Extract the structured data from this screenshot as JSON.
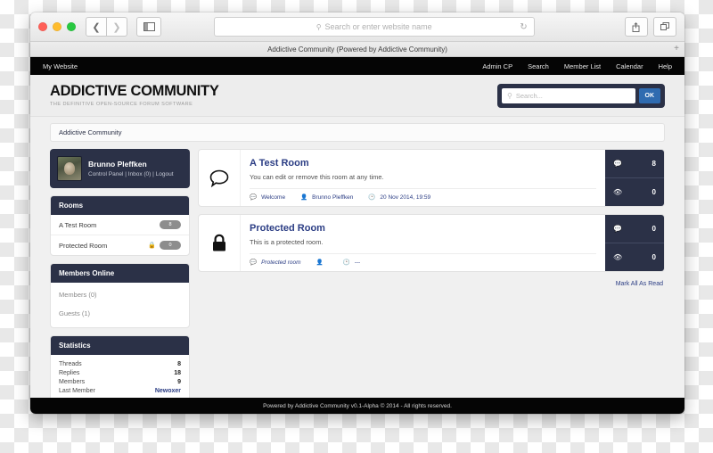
{
  "browser": {
    "url_placeholder": "Search or enter website name",
    "tab_title": "Addictive Community (Powered by Addictive Community)",
    "back_icon": "chevron-left-icon",
    "forward_icon": "chevron-right-icon",
    "sidebar_icon": "sidebar-toggle-icon",
    "reload_icon": "reload-icon",
    "share_icon": "share-icon",
    "tabs_icon": "tabs-icon",
    "new_tab_label": "+"
  },
  "topnav": {
    "site_label": "My Website",
    "items": [
      "Admin CP",
      "Search",
      "Member List",
      "Calendar",
      "Help"
    ]
  },
  "header": {
    "logo_title": "ADDICTIVE COMMUNITY",
    "logo_subtitle": "THE DEFINITIVE OPEN-SOURCE FORUM SOFTWARE",
    "search_placeholder": "Search...",
    "search_value": "",
    "search_button": "OK"
  },
  "breadcrumb": "Addictive Community",
  "sidebar": {
    "user": {
      "name": "Brunno Pleffken",
      "links": "Control Panel | Inbox (0) | Logout"
    },
    "rooms": {
      "title": "Rooms",
      "items": [
        {
          "label": "A Test Room",
          "count": "8",
          "locked": false
        },
        {
          "label": "Protected Room",
          "count": "0",
          "locked": true
        }
      ]
    },
    "members_online": {
      "title": "Members Online",
      "items": [
        "Members (0)",
        "Guests (1)"
      ]
    },
    "statistics": {
      "title": "Statistics",
      "rows": [
        {
          "label": "Threads",
          "value": "8",
          "link": false
        },
        {
          "label": "Replies",
          "value": "18",
          "link": false
        },
        {
          "label": "Members",
          "value": "9",
          "link": false
        },
        {
          "label": "Last Member",
          "value": "Newoxer",
          "link": true
        }
      ]
    }
  },
  "main": {
    "rooms": [
      {
        "icon": "speech-bubble-icon",
        "title": "A Test Room",
        "description": "You can edit or remove this room at any time.",
        "meta_thread": "Welcome",
        "meta_author": "Brunno Pleffken",
        "meta_date": "20 Nov 2014, 19:59",
        "threads": "8",
        "views": "0",
        "italic_meta": false
      },
      {
        "icon": "lock-icon",
        "title": "Protected Room",
        "description": "This is a protected room.",
        "meta_thread": "Protected room",
        "meta_author": "",
        "meta_date": "---",
        "threads": "0",
        "views": "0",
        "italic_meta": true
      }
    ],
    "mark_all_read": "Mark All As Read"
  },
  "footer": "Powered by Addictive Community v0.1-Alpha © 2014 - All rights reserved.",
  "colors": {
    "navy": "#2b3147",
    "link": "#2b3d84",
    "accent": "#2f6bb0",
    "black_bar": "#050505"
  }
}
